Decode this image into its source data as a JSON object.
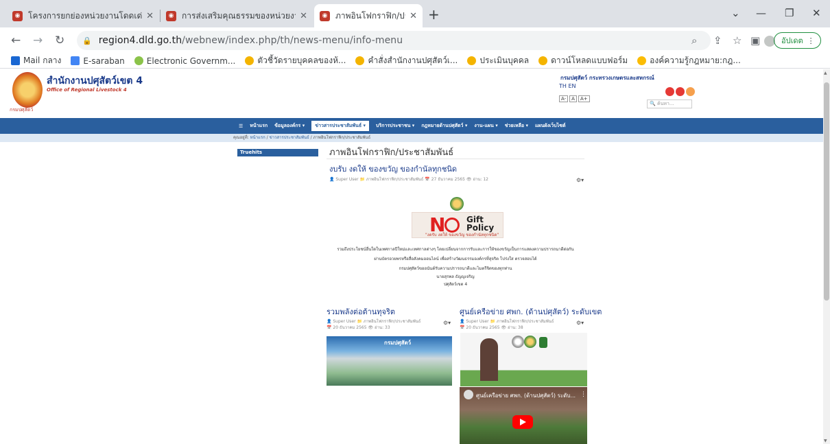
{
  "browser": {
    "tabs": [
      {
        "title": "โครงการยกย่องหน่วยงานโดดเด่นด้านความสะอาด"
      },
      {
        "title": "การส่งเสริมคุณธรรมของหน่วยงาน"
      },
      {
        "title": "ภาพอินโฟกราฟิก/ประชาสัมพันธ์"
      }
    ],
    "url_host": "region4.dld.go.th",
    "url_path": "/webnew/index.php/th/news-menu/info-menu",
    "update_label": "อัปเดต",
    "bookmarks": [
      {
        "label": "Mail กลาง",
        "color": "#1967d2"
      },
      {
        "label": "E-saraban",
        "color": "#4285f4"
      },
      {
        "label": "Electronic Governm...",
        "color": "#8bc34a"
      },
      {
        "label": "ตัวชี้วัดรายบุคคลของห้...",
        "color": "#f4b400"
      },
      {
        "label": "คำสั่งสำนักงานปศุสัตว์เ...",
        "color": "#f4b400"
      },
      {
        "label": "ประเมินบุคคล",
        "color": "#f4b400"
      },
      {
        "label": "ดาวน์โหลดแบบฟอร์ม",
        "color": "#f4b400"
      },
      {
        "label": "องค์ความรู้กฎหมาย:กฎ...",
        "color": "#fbbc04"
      }
    ]
  },
  "site": {
    "org_th": "สำนักงานปศุสัตว์เขต 4",
    "org_en": "Office of Regional Livestock 4",
    "logo_caption": "กรมปศุสัตว์",
    "header_links": "กรมปศุสัตว์  กระทรวงเกษตรและสหกรณ์",
    "lang": "TH  EN",
    "font_sizes": [
      "A-",
      "A",
      "A+"
    ],
    "search_placeholder": "ค้นหา...",
    "nav": [
      {
        "label": "☰"
      },
      {
        "label": "หน้าแรก"
      },
      {
        "label": "ข้อมูลองค์กร ▾"
      },
      {
        "label": "ข่าวสารประชาสัมพันธ์ ▾"
      },
      {
        "label": "บริการประชาชน ▾"
      },
      {
        "label": "กฎหมายด้านปศุสัตว์ ▾"
      },
      {
        "label": "งาน-แผน ▾"
      },
      {
        "label": "ช่วยเหลือ ▾"
      },
      {
        "label": "แผนผังเว็บไซต์"
      }
    ],
    "breadcrumb_prefix": "คุณอยู่ที่:",
    "breadcrumb": [
      "หน้าแรก",
      "ข่าวสารประชาสัมพันธ์",
      "ภาพอินโฟกราฟิก/ประชาสัมพันธ์"
    ],
    "sidebar_tag": "Truehits",
    "page_title": "ภาพอินโฟกราฟิก/ประชาสัมพันธ์"
  },
  "articles": [
    {
      "title": "งบรับ งดให้ ของขวัญ ของกำนัลทุกชนิด",
      "meta": "👤 Super User  📁 ภาพอินโฟกราฟิก/ประชาสัมพันธ์  📅 27 ธันวาคม 2565  👁 อ่าน: 12",
      "image_no": "N",
      "image_gift": "Gift",
      "image_policy": "Policy",
      "image_caption": "\"งดรับ งดให้ ของขวัญ ของกำนัลทุกชนิด\"",
      "body": [
        "รวมถึงประโยชน์อื่นใดในเทศกาลปีใหม่และเทศกาลต่างๆ โดยเปลี่ยนจากการรับและการให้ของขวัญเป็นการแสดงความปรารถนาดีต่อกัน",
        "ผ่านบัตรอวยพรหรือสื่อสังคมออนไลน์ เพื่อสร้างวัฒนธรรมองค์กรที่สุจริต โปร่งใส ตรวจสอบได้",
        "กรมปศุสัตว์ขออนันต์รับความปรารถนาดีและไมตรีจิตของทุกท่าน",
        "นายสุรพล ธัญญเจริญ",
        "ปศุสัตว์เขต 4"
      ]
    },
    {
      "title": "รวมพลังต่อต้านทุจริต",
      "meta": "👤 Super User  📁 ภาพอินโฟกราฟิก/ประชาสัมพันธ์",
      "meta2": "📅 20 ธันวาคม 2565  👁 อ่าน: 33",
      "image_label": "กรมปศุสัตว์"
    },
    {
      "title": "ศูนย์เครือข่าย ศพก. (ด้านปศุสัตว์) ระดับเขต",
      "meta": "👤 Super User  📁 ภาพอินโฟกราฟิก/ประชาสัมพันธ์",
      "meta2": "📅 20 ธันวาคม 2565  👁 อ่าน: 38",
      "video_title": "ศูนย์เครือข่าย ศพก. (ด้านปศุสัตว์) ระดับ..."
    }
  ]
}
